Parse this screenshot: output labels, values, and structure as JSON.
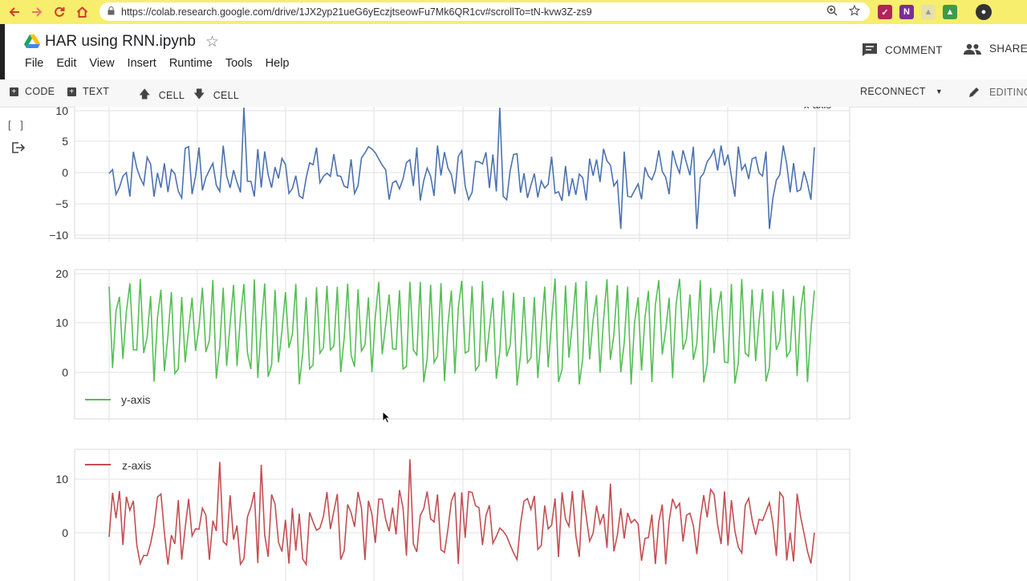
{
  "browser": {
    "url": "https://colab.research.google.com/drive/1JX2yp21ueG6yEczjtseowFu7Mk6QR1cv#scrollTo=tN-kvw3Z-zs9",
    "icons": [
      "back-icon",
      "forward-icon",
      "reload-icon",
      "home-icon",
      "lock-icon",
      "zoom-icon",
      "bookmark-star-icon"
    ]
  },
  "notebook": {
    "title": "HAR using RNN.ipynb",
    "menu": [
      "File",
      "Edit",
      "View",
      "Insert",
      "Runtime",
      "Tools",
      "Help"
    ],
    "comment_label": "COMMENT",
    "share_label": "SHARE"
  },
  "toolbar": {
    "code_label": "CODE",
    "text_label": "TEXT",
    "cell_up_label": "CELL",
    "cell_down_label": "CELL",
    "reconnect_label": "RECONNECT",
    "editing_label": "EDITING"
  },
  "cell": {
    "run_indicator": "[ ]"
  },
  "colors": {
    "x": "#4c72b0",
    "y": "#55bf55",
    "z": "#c44e52",
    "browser_bar": "#f6ee6c"
  },
  "chart_data": [
    {
      "type": "line",
      "series": [
        {
          "name": "x-axis"
        }
      ],
      "yticks": [
        "10",
        "5",
        "0",
        "−5",
        "−10"
      ],
      "ylim": [
        -10,
        10
      ],
      "grid": true,
      "legend": "top-right (partially clipped)",
      "n_points": 205,
      "seed": 7,
      "amp": 4.5,
      "peaks": [
        [
          39,
          10.5
        ],
        [
          113,
          10.5
        ],
        [
          148,
          -9
        ],
        [
          170,
          -9
        ],
        [
          191,
          -9
        ]
      ]
    },
    {
      "type": "line",
      "series": [
        {
          "name": "y-axis"
        }
      ],
      "yticks": [
        "20",
        "10",
        "0"
      ],
      "ylim": [
        -7,
        20.5
      ],
      "grid": true,
      "legend": "bottom-left",
      "n_points": 205,
      "seed": 13,
      "base": 8,
      "amp": 11
    },
    {
      "type": "line",
      "series": [
        {
          "name": "z-axis"
        }
      ],
      "yticks": [
        "10",
        "0"
      ],
      "ylim": [
        -8,
        15
      ],
      "grid": true,
      "legend": "top-left",
      "n_points": 205,
      "seed": 29,
      "base": 2,
      "amp": 7,
      "peaks": [
        [
          32,
          14
        ],
        [
          44,
          13.5
        ],
        [
          87,
          14.5
        ],
        [
          145,
          10
        ]
      ]
    }
  ]
}
